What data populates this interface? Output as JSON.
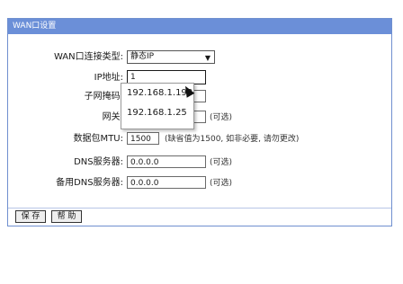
{
  "header": {
    "title": "WAN口设置"
  },
  "form": {
    "conn_type": {
      "label": "WAN口连接类型:",
      "value": "静态IP"
    },
    "ip": {
      "label": "IP地址:",
      "value": "1"
    },
    "mask": {
      "label": "子网掩码:"
    },
    "gateway": {
      "label": "网关:",
      "hint": "(可选)"
    },
    "mtu": {
      "label": "数据包MTU:",
      "value": "1500",
      "hint": "(缺省值为1500, 如非必要, 请勿更改)"
    },
    "dns": {
      "label": "DNS服务器:",
      "value": "0.0.0.0",
      "hint": "(可选)"
    },
    "dns2": {
      "label": "备用DNS服务器:",
      "value": "0.0.0.0",
      "hint": "(可选)"
    }
  },
  "autocomplete": {
    "items": [
      "192.168.1.198",
      "192.168.1.25"
    ]
  },
  "buttons": {
    "save": "保 存",
    "help": "帮 助"
  },
  "colors": {
    "header_bg": "#6b8fd8",
    "border": "#6f8fcf"
  }
}
